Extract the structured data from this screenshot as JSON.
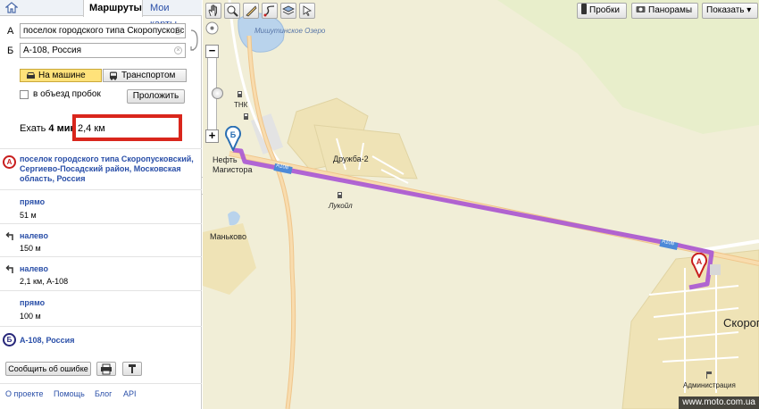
{
  "tabs": {
    "routes": "Маршруты",
    "my_maps": "Мои карты"
  },
  "route": {
    "point_a_letter": "А",
    "point_b_letter": "Б",
    "point_a_value": "поселок городского типа Скоропусковс",
    "point_b_value": "А-108, Россия",
    "clear_glyph": "×",
    "mode_car": "На машине",
    "mode_transit": "Транспортом",
    "avoid_traffic": "в объезд пробок",
    "build_button": "Проложить",
    "summary_prefix": "Ехать",
    "summary_time": "4 мин",
    "distance": "2,4 км",
    "highlight_color": "#d9261c"
  },
  "steps": {
    "origin_mark": "А",
    "origin": "поселок городского типа Скоропусковский, Сергиево-Посадский район, Московская область, Россия",
    "items": [
      {
        "title": "прямо",
        "detail": "51 м"
      },
      {
        "title": "налево",
        "detail": "150 м"
      },
      {
        "title": "налево",
        "detail": "2,1 км, А-108"
      },
      {
        "title": "прямо",
        "detail": "100 м"
      }
    ],
    "dest_mark": "Б",
    "destination": "А-108, Россия"
  },
  "actions": {
    "report_error": "Сообщить об ошибке"
  },
  "footer": {
    "about": "О проекте",
    "help": "Помощь",
    "blog": "Блог",
    "api": "API"
  },
  "map": {
    "traffic": "Пробки",
    "panoramas": "Панорамы",
    "show": "Показать ▾",
    "zoom_plus": "+",
    "zoom_minus": "−",
    "labels": {
      "lake": "Мишутинское Озеро",
      "tnk": "ТНК",
      "neft": "Нефть",
      "magistor": "Магистора",
      "druzhba": "Дружба-2",
      "lukoil": "Лукойл",
      "mankovo": "Маньково",
      "village": "Скороп",
      "admin": "Администрация",
      "road_sign_1": "А108",
      "road_sign_2": "А108"
    },
    "pin_a": "А",
    "pin_b": "Б",
    "route_color": "#a955d4",
    "watermark": "www.moto.com.ua"
  }
}
